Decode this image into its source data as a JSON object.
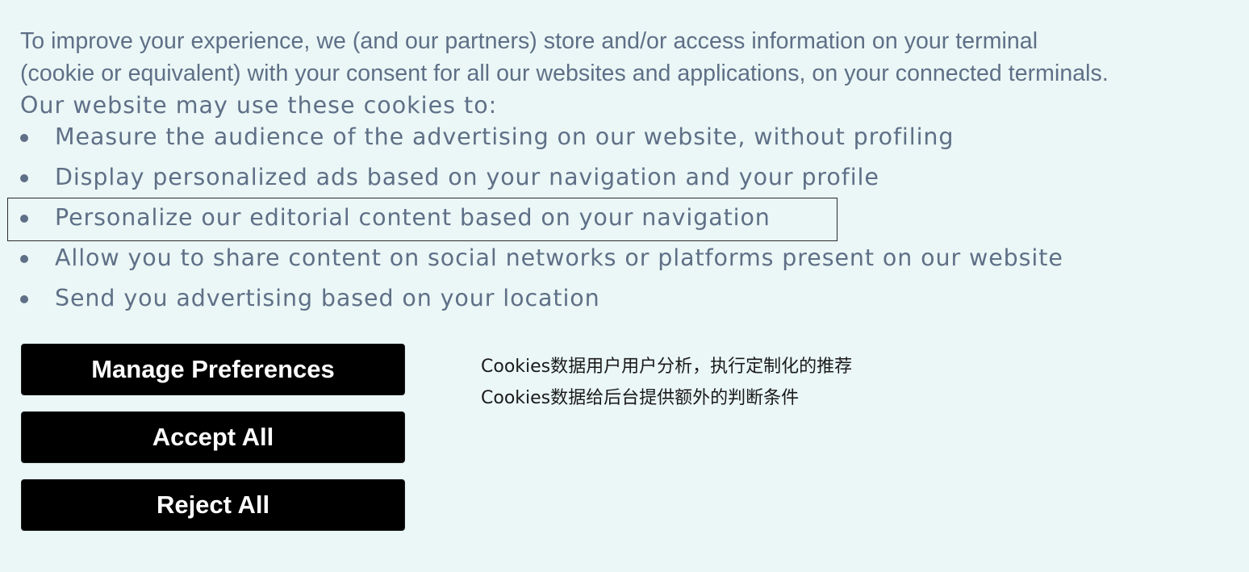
{
  "intro": {
    "line1": "To improve your experience, we (and our partners) store and/or access information on your terminal",
    "line2": "(cookie or equivalent) with your consent for all our websites and applications, on your connected terminals."
  },
  "lead": "Our website may use these cookies to:",
  "purposes": [
    "Measure the audience of the advertising on our website, without profiling",
    "Display personalized ads based on your navigation and your profile",
    "Personalize our editorial content based on your navigation",
    "Allow you to share content on social networks or platforms present on our website",
    "Send you advertising based on your location"
  ],
  "buttons": {
    "manage": "Manage Preferences",
    "accept": "Accept All",
    "reject": "Reject All"
  },
  "notes": [
    "Cookies数据用户用户分析，执行定制化的推荐",
    "Cookies数据给后台提供额外的判断条件"
  ]
}
